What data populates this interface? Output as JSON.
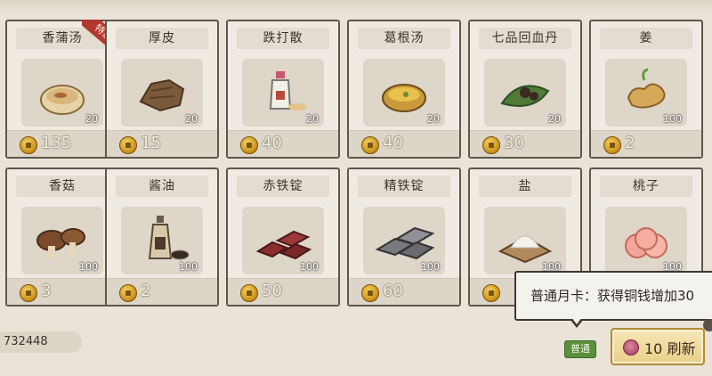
{
  "items": [
    {
      "name": "香蒲汤",
      "qty": "20",
      "price": "135",
      "badge": "特惠",
      "icon": "herb-soup-bowl-icon"
    },
    {
      "name": "厚皮",
      "qty": "20",
      "price": "15",
      "icon": "thick-hide-icon"
    },
    {
      "name": "跌打散",
      "qty": "20",
      "price": "40",
      "icon": "medicine-bottle-icon"
    },
    {
      "name": "葛根汤",
      "qty": "20",
      "price": "40",
      "icon": "kudzu-soup-icon"
    },
    {
      "name": "七品回血丹",
      "qty": "20",
      "price": "30",
      "icon": "healing-pill-icon"
    },
    {
      "name": "姜",
      "qty": "100",
      "price": "2",
      "icon": "ginger-icon"
    },
    {
      "name": "香菇",
      "qty": "100",
      "price": "3",
      "icon": "mushroom-icon"
    },
    {
      "name": "酱油",
      "qty": "100",
      "price": "2",
      "icon": "soy-sauce-bottle-icon"
    },
    {
      "name": "赤铁锭",
      "qty": "100",
      "price": "50",
      "icon": "red-iron-ingot-icon"
    },
    {
      "name": "精铁锭",
      "qty": "100",
      "price": "60",
      "icon": "steel-ingot-icon"
    },
    {
      "name": "盐",
      "qty": "100",
      "price": "",
      "icon": "salt-icon"
    },
    {
      "name": "桃子",
      "qty": "100",
      "price": "",
      "icon": "peach-icon"
    }
  ],
  "currency": {
    "amount": "732448"
  },
  "tooltip": {
    "text": "普通月卡：获得铜钱增加30"
  },
  "card_badge": {
    "label": "普通"
  },
  "refresh": {
    "label": "10 刷新"
  },
  "colors": {
    "frame": "#5f564b",
    "price_bg": "#ddd5c7",
    "badge_red": "#b1382e",
    "button_gold": "#e9cf88"
  }
}
